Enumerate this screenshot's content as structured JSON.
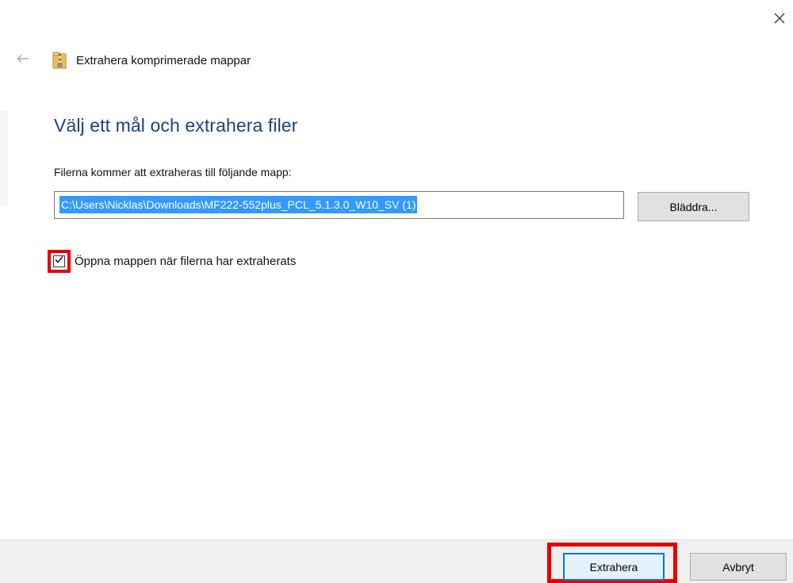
{
  "window": {
    "title": "Extrahera komprimerade mappar",
    "close_icon": "close-icon",
    "back_icon": "back-arrow-icon",
    "folder_icon": "zip-folder-icon"
  },
  "main": {
    "heading": "Välj ett mål och extrahera filer",
    "destination_label": "Filerna kommer att extraheras till följande mapp:",
    "destination_path": "C:\\Users\\Nicklas\\Downloads\\MF222-552plus_PCL_5.1.3.0_W10_SV (1)",
    "browse_label": "Bläddra...",
    "open_folder_checkbox": {
      "label": "Öppna mappen när filerna har extraherats",
      "checked": true
    }
  },
  "footer": {
    "extract_label": "Extrahera",
    "cancel_label": "Avbryt"
  },
  "colors": {
    "heading": "#1e3f86",
    "selection": "#3399ff",
    "highlight": "#e60000",
    "primary_border": "#0078d7"
  }
}
